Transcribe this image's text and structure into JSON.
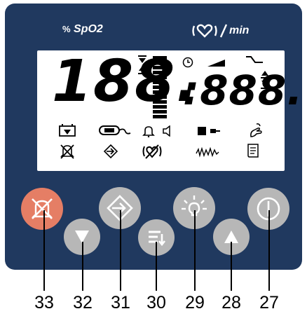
{
  "panel": {
    "spo2_header": {
      "prefix": "%",
      "label": "SpO2",
      "icon": "heart-icon"
    },
    "pulse_header": {
      "unit": "min"
    },
    "lcd": {
      "spo2_value": "188.",
      "pulse_value": ":888."
    }
  },
  "buttons": [
    {
      "callout": "33",
      "icon": "alarm-mute-icon",
      "color": "#e57e65"
    },
    {
      "callout": "32",
      "icon": "triangle-down-icon"
    },
    {
      "callout": "31",
      "icon": "enter-icon"
    },
    {
      "callout": "30",
      "icon": "menu-icon"
    },
    {
      "callout": "29",
      "icon": "brightness-icon"
    },
    {
      "callout": "28",
      "icon": "triangle-up-icon"
    },
    {
      "callout": "27",
      "icon": "power-icon"
    }
  ],
  "colors": {
    "panel": "#20395f",
    "button": "#b7b7b7",
    "alarm_button": "#e57e65"
  }
}
